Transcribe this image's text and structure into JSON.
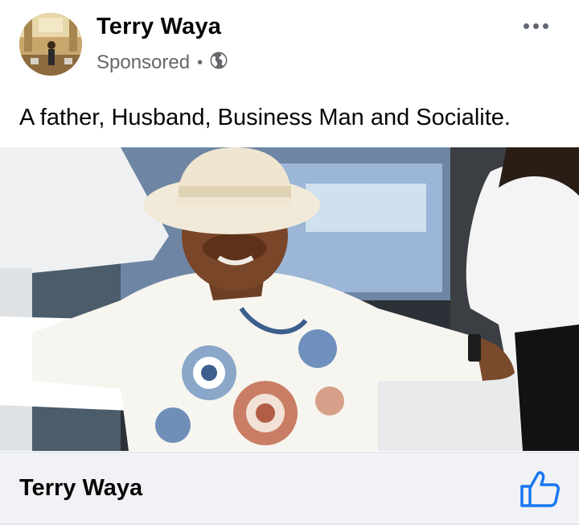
{
  "post": {
    "author": "Terry Waya",
    "sponsored_label": "Sponsored",
    "separator": "•",
    "audience_icon": "globe-icon",
    "more_icon": "more-horizontal-icon",
    "caption": "A father, Husband, Business Man and Socialite."
  },
  "footer": {
    "page_name": "Terry Waya",
    "like_icon": "thumbs-up-icon"
  },
  "colors": {
    "text_primary": "#050505",
    "text_secondary": "#65676b",
    "like_blue": "#1877f2",
    "footer_bg": "#f0f2f5"
  }
}
